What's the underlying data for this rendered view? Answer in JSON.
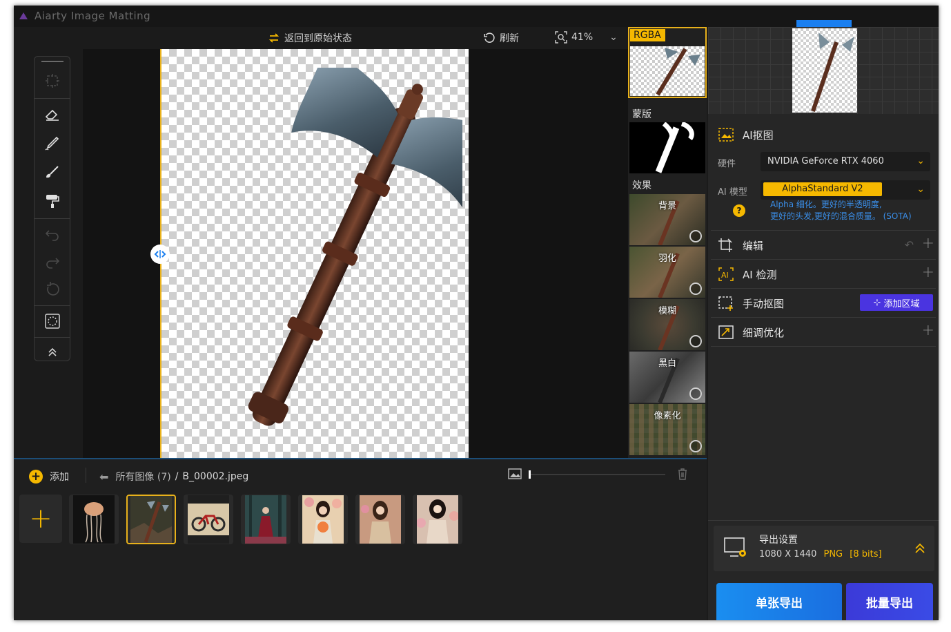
{
  "window": {
    "title": "Aiarty Image Matting"
  },
  "canvas_toolbar": {
    "restore_label": "返回到原始状态",
    "refresh_label": "刷新",
    "zoom": "41%"
  },
  "effects_strip": {
    "rgba_tag": "RGBA",
    "mask_label": "蒙版",
    "effects_label": "效果",
    "effects": [
      "背景",
      "羽化",
      "模糊",
      "黑白",
      "像素化"
    ]
  },
  "filmstrip": {
    "add_label": "添加",
    "breadcrumb_all": "所有图像 (7)",
    "breadcrumb_sep": "/",
    "breadcrumb_file": "B_00002.jpeg",
    "zoom_slider_value": 0.0
  },
  "right_panel": {
    "ai_matting": {
      "title": "AI抠图",
      "hardware_label": "硬件",
      "hardware_value": "NVIDIA GeForce RTX 4060",
      "model_label": "AI 模型",
      "model_value": "AlphaStandard  V2",
      "hint_line1": "Alpha 细化。更好的半透明度,",
      "hint_line2": "更好的头发,更好的混合质量。 (SOTA)"
    },
    "sections": {
      "edit": "编辑",
      "ai_detect": "AI 检测",
      "manual": "手动抠图",
      "manual_button": "添加区域",
      "refine": "细调优化"
    },
    "export": {
      "title": "导出设置",
      "size": "1080 X 1440",
      "format": "PNG",
      "bits": "[8 bits]",
      "single_button": "单张导出",
      "batch_button": "批量导出"
    }
  },
  "colors": {
    "accent_yellow": "#f5b800",
    "blue": "#1a8ef0",
    "purple": "#4a34e0"
  }
}
